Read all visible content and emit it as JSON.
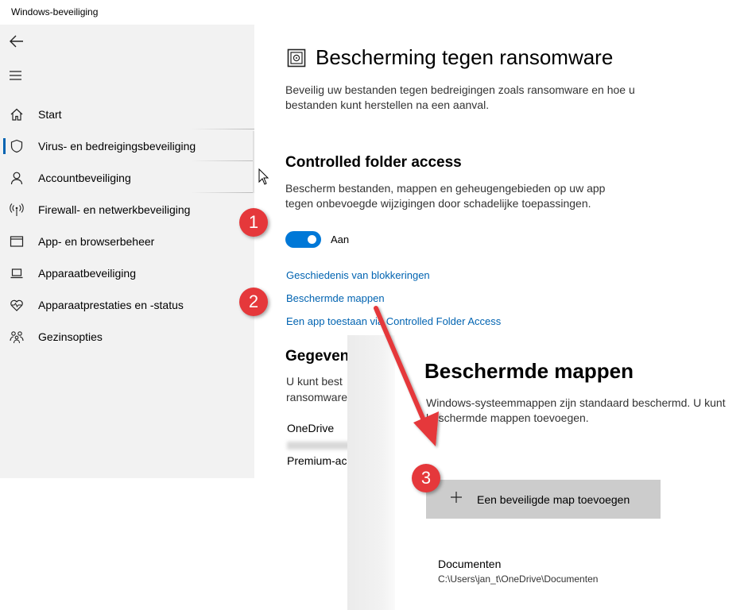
{
  "window": {
    "title": "Windows-beveiliging"
  },
  "sidebar": {
    "back_icon": "back-arrow-icon",
    "menu_icon": "hamburger-menu-icon",
    "items": [
      {
        "label": "Start",
        "icon": "home-icon"
      },
      {
        "label": "Virus- en bedreigingsbeveiliging",
        "icon": "shield-icon",
        "active": true
      },
      {
        "label": "Accountbeveiliging",
        "icon": "person-icon"
      },
      {
        "label": "Firewall- en netwerkbeveiliging",
        "icon": "antenna-icon"
      },
      {
        "label": "App- en browserbeheer",
        "icon": "browser-window-icon"
      },
      {
        "label": "Apparaatbeveiliging",
        "icon": "laptop-icon"
      },
      {
        "label": "Apparaatprestaties en -status",
        "icon": "heart-pulse-icon"
      },
      {
        "label": "Gezinsopties",
        "icon": "family-icon"
      }
    ]
  },
  "main": {
    "title": "Bescherming tegen ransomware",
    "description": "Beveilig uw bestanden tegen bedreigingen zoals ransomware en hoe u bestanden kunt herstellen na een aanval.",
    "cfa": {
      "title": "Controlled folder access",
      "description": "Bescherm bestanden, mappen en geheugengebieden op uw app tegen onbevoegde wijzigingen door schadelijke toepassingen.",
      "toggle_state": "on",
      "toggle_label": "Aan",
      "links": [
        "Geschiedenis van blokkeringen",
        "Beschermde mappen",
        "Een app toestaan via Controlled Folder Access"
      ]
    },
    "recovery": {
      "title": "Gegeven",
      "desc_line1": "U kunt best",
      "desc_line2": "ransomware",
      "provider": "OneDrive",
      "account": "Premium-ac"
    }
  },
  "overlay": {
    "title": "Beschermde mappen",
    "description": "Windows-systeemmappen zijn standaard beschermd. U kunt beschermde mappen toevoegen.",
    "add_button": "Een beveiligde map toevoegen",
    "folder": {
      "name": "Documenten",
      "path": "C:\\Users\\jan_t\\OneDrive\\Documenten"
    }
  },
  "annotations": {
    "badges": [
      "1",
      "2",
      "3"
    ],
    "accent": "#e5383b"
  },
  "colors": {
    "accent": "#0078d7",
    "link": "#0063b1",
    "sidebar_bg": "#f2f2f2",
    "button_bg": "#cccccc"
  }
}
